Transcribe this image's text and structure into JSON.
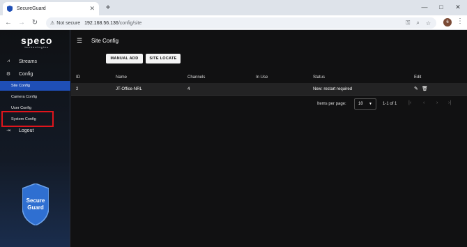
{
  "browser": {
    "tab_title": "SecureGuard",
    "new_tab": "+",
    "not_secure": "Not secure",
    "url_host": "192.168.56.136",
    "url_path": "/config/site",
    "minimize": "—",
    "maximize": "□",
    "close": "✕",
    "avatar": "6"
  },
  "sidebar": {
    "logo": "speco",
    "logo_sub": "technologies",
    "streams": "Streams",
    "config": "Config",
    "sub_items": [
      "Site Config",
      "Camera Config",
      "User Config",
      "System Config"
    ],
    "logout": "Logout",
    "badge_top": "Secure",
    "badge_bottom": "Guard"
  },
  "main": {
    "title": "Site Config",
    "manual_add": "MANUAL ADD",
    "site_locate": "SITE LOCATE",
    "columns": [
      "ID",
      "Name",
      "Channels",
      "In Use",
      "Status",
      "Edit"
    ],
    "rows": [
      {
        "id": "2",
        "name": "JT-Office-NRL",
        "channels": "4",
        "in_use": "",
        "status": "New: restart required"
      }
    ],
    "items_per_page_label": "Items per page:",
    "items_per_page": "10",
    "range": "1-1 of 1"
  },
  "colors": {
    "accent": "#1f4fb6",
    "highlight": "#e0151c"
  }
}
